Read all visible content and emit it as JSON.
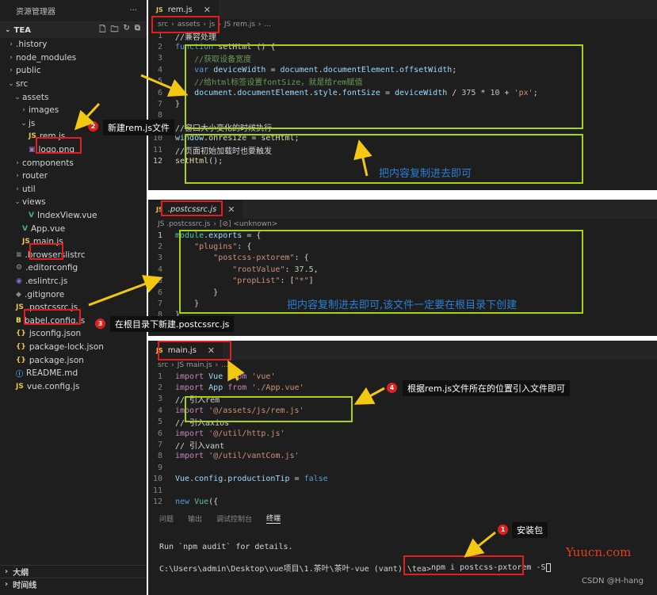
{
  "explorer": {
    "title": "资源管理器",
    "more": "···",
    "root": "TEA",
    "items": [
      {
        "label": ".history",
        "chev": "›",
        "icon": "",
        "depth": 1,
        "type": "folder"
      },
      {
        "label": "node_modules",
        "chev": "›",
        "icon": "",
        "depth": 1,
        "type": "folder"
      },
      {
        "label": "public",
        "chev": "›",
        "icon": "",
        "depth": 1,
        "type": "folder"
      },
      {
        "label": "src",
        "chev": "⌄",
        "icon": "",
        "depth": 1,
        "type": "folder"
      },
      {
        "label": "assets",
        "chev": "⌄",
        "icon": "",
        "depth": 2,
        "type": "folder"
      },
      {
        "label": "images",
        "chev": "›",
        "icon": "",
        "depth": 3,
        "type": "folder"
      },
      {
        "label": "js",
        "chev": "⌄",
        "icon": "",
        "depth": 3,
        "type": "folder"
      },
      {
        "label": "rem.js",
        "chev": "",
        "icon": "JS",
        "depth": 3,
        "type": "js"
      },
      {
        "label": "logo.png",
        "chev": "",
        "icon": "▣",
        "depth": 3,
        "type": "img"
      },
      {
        "label": "components",
        "chev": "›",
        "icon": "",
        "depth": 2,
        "type": "folder"
      },
      {
        "label": "router",
        "chev": "›",
        "icon": "",
        "depth": 2,
        "type": "folder"
      },
      {
        "label": "util",
        "chev": "›",
        "icon": "",
        "depth": 2,
        "type": "folder"
      },
      {
        "label": "views",
        "chev": "⌄",
        "icon": "",
        "depth": 2,
        "type": "folder"
      },
      {
        "label": "IndexView.vue",
        "chev": "",
        "icon": "V",
        "depth": 3,
        "type": "vue"
      },
      {
        "label": "App.vue",
        "chev": "",
        "icon": "V",
        "depth": 2,
        "type": "vue"
      },
      {
        "label": "main.js",
        "chev": "",
        "icon": "JS",
        "depth": 2,
        "type": "js"
      },
      {
        "label": ".browserslistrc",
        "chev": "",
        "icon": "≡",
        "depth": 1,
        "type": "cfg"
      },
      {
        "label": ".editorconfig",
        "chev": "",
        "icon": "⚙",
        "depth": 1,
        "type": "cfg"
      },
      {
        "label": ".eslintrc.js",
        "chev": "",
        "icon": "◉",
        "depth": 1,
        "type": "eslint"
      },
      {
        "label": ".gitignore",
        "chev": "",
        "icon": "◆",
        "depth": 1,
        "type": "git"
      },
      {
        "label": ".postcssrc.js",
        "chev": "",
        "icon": "JS",
        "depth": 1,
        "type": "js"
      },
      {
        "label": "babel.config.js",
        "chev": "",
        "icon": "B",
        "depth": 1,
        "type": "babel"
      },
      {
        "label": "jsconfig.json",
        "chev": "",
        "icon": "{}",
        "depth": 1,
        "type": "json"
      },
      {
        "label": "package-lock.json",
        "chev": "",
        "icon": "{}",
        "depth": 1,
        "type": "json"
      },
      {
        "label": "package.json",
        "chev": "",
        "icon": "{}",
        "depth": 1,
        "type": "json"
      },
      {
        "label": "README.md",
        "chev": "",
        "icon": "ⓘ",
        "depth": 1,
        "type": "md"
      },
      {
        "label": "vue.config.js",
        "chev": "",
        "icon": "JS",
        "depth": 1,
        "type": "js"
      }
    ],
    "outline": "大纲",
    "timeline": "时间线"
  },
  "notes": {
    "n1": {
      "num": "1",
      "text": "安装包"
    },
    "n2": {
      "num": "2",
      "text": "新建rem.js文件"
    },
    "n3": {
      "num": "3",
      "text": "在根目录下新建.postcssrc.js"
    },
    "n4": {
      "num": "4",
      "text": "根据rem.js文件所在的位置引入文件即可"
    }
  },
  "editor1": {
    "tab": "rem.js",
    "tab_icon": "JS",
    "crumbs": [
      "src",
      "›",
      "assets",
      "›",
      "js",
      "›",
      "JS rem.js",
      "›",
      "..."
    ],
    "annotation": "把内容复制进去即可"
  },
  "editor2": {
    "tab": ".postcssrc.js",
    "tab_icon": "JS",
    "crumbs": [
      "JS .postcssrc.js",
      "›",
      "[⊘] <unknown>"
    ],
    "annotation": "把内容复制进去即可,该文件一定要在根目录下创建"
  },
  "editor3": {
    "tab": "main.js",
    "tab_icon": "JS",
    "crumbs": [
      "src",
      "›",
      "JS main.js",
      "›",
      "..."
    ]
  },
  "terminal": {
    "tabs": [
      "问题",
      "输出",
      "调试控制台",
      "终端"
    ],
    "active": "终端",
    "line1": "Run `npm audit` for details.",
    "prompt": "C:\\Users\\admin\\Desktop\\vue项目\\1.茶叶\\茶叶-vue (vant) \\tea>",
    "command": "npm i postcss-pxtorem -S"
  },
  "watermark": "Yuucn.com",
  "csdn": "CSDN @H-hang"
}
